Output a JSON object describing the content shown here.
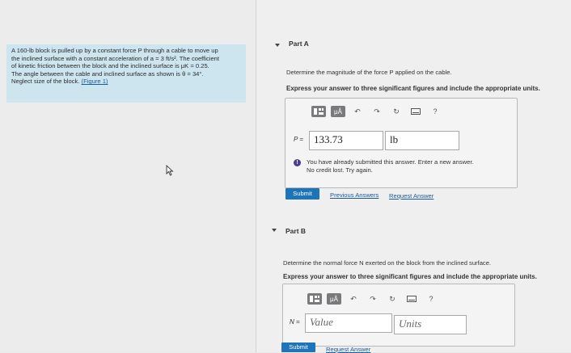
{
  "problem": {
    "line1": "A 160-lb block is pulled up by a constant force P through a cable to move up",
    "line2": "the inclined surface with a constant acceleration of a = 3 ft/s². The coefficient",
    "line3": "of kinetic friction between the block and the inclined surface is μK = 0.25.",
    "line4": "The angle between the cable and inclined surface as shown is θ = 34°.",
    "line5": "Neglect size of the block.",
    "figure_link": "(Figure 1)"
  },
  "partA": {
    "title": "Part A",
    "question": "Determine the magnitude of the force P applied on the cable.",
    "instruction": "Express your answer to three significant figures and include the appropriate units.",
    "var_label": "P =",
    "value": "133.73",
    "units": "lb",
    "error_line1": "You have already submitted this answer. Enter a new answer.",
    "error_line2": "No credit lost. Try again.",
    "submit_label": "Submit",
    "previous_answers": "Previous Answers",
    "request_answer": "Request Answer"
  },
  "partB": {
    "title": "Part B",
    "question": "Determine the normal force N exerted on the block from the inclined surface.",
    "instruction": "Express your answer to three significant figures and include the appropriate units.",
    "var_label": "N =",
    "value_placeholder": "Value",
    "units_placeholder": "Units",
    "submit_label": "Submit",
    "request_answer": "Request Answer"
  },
  "toolbar": {
    "mu_label": "μÅ",
    "help_label": "?"
  },
  "icons": [
    "templates-icon",
    "units-icon",
    "undo-icon",
    "redo-icon",
    "reset-icon",
    "keyboard-icon",
    "help-icon",
    "caret-down-icon",
    "alert-icon",
    "cursor-icon"
  ]
}
